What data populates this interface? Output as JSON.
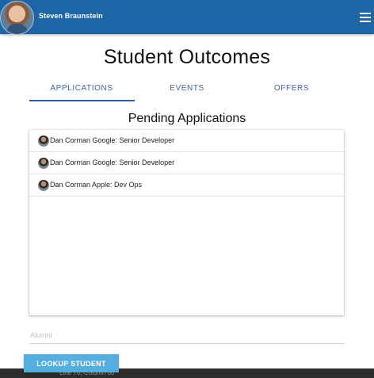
{
  "header": {
    "user_name": "Steven Braunstein"
  },
  "page": {
    "title": "Student Outcomes"
  },
  "tabs": [
    {
      "label": "APPLICATIONS"
    },
    {
      "label": "EVENTS"
    },
    {
      "label": "OFFERS"
    }
  ],
  "section": {
    "title": "Pending Applications"
  },
  "applications": [
    {
      "text": "Dan Corman Google: Senior Developer"
    },
    {
      "text": "Dan Corman Google: Senior Developer"
    },
    {
      "text": "Dan Corman Apple: Dev Ops"
    }
  ],
  "search": {
    "placeholder": "Alumni",
    "value": ""
  },
  "actions": {
    "lookup_label": "LOOKUP STUDENT"
  },
  "status_bar": {
    "text": "Line 76, Column 68"
  },
  "colors": {
    "header": "#1e65a8",
    "tab_text": "#40659a",
    "tab_indicator": "#2e5c96",
    "button": "#55aee0"
  },
  "icons": {
    "menu": "hamburger-menu-icon",
    "user": "avatar"
  },
  "state": {
    "active_tab": "APPLICATIONS"
  }
}
